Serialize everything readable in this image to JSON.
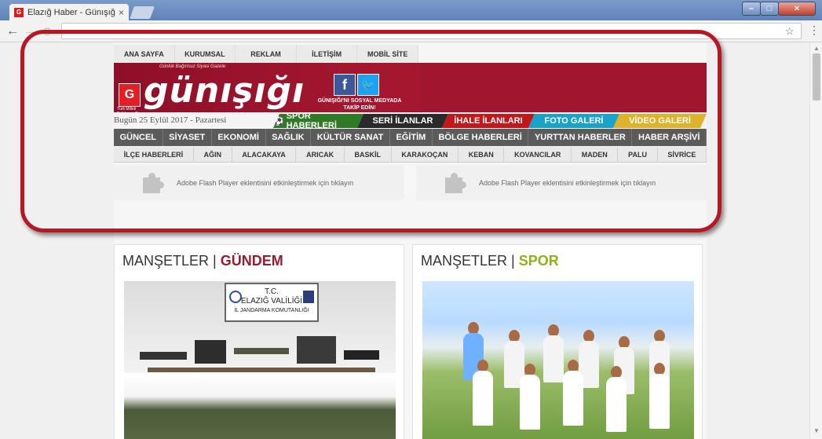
{
  "browser": {
    "tab_title": "Elazığ Haber - Günışığı G",
    "tab_close": "×",
    "tab_favicon": "G",
    "url": "",
    "icons": [
      "back-arrow-icon",
      "forward-arrow-icon",
      "reload-icon",
      "star-icon",
      "menu-dots-icon"
    ],
    "window_controls": {
      "minimize": "–",
      "maximize": "□",
      "close": "×"
    }
  },
  "site": {
    "top_menu": [
      "ANA SAYFA",
      "KURUMSAL",
      "REKLAM",
      "İLETİŞİM",
      "MOBİL SİTE"
    ],
    "logo_text": "günışığı",
    "logo_tagline": "Günlük Bağımsız Siyasi Gazete",
    "logo_flag": "G",
    "logo_sub": "Türk Milleti Belirleyen Bir Gazetedir",
    "social_text_line1": "GÜNIŞIĞI'NI SOSYAL MEDYADA",
    "social_text_line2": "TAKİP EDİN!",
    "date": "Bugün 25 Eylül 2017 - Pazartesi",
    "color_tabs": [
      {
        "label": "SPOR HABERLERİ",
        "color": "#2f7a26"
      },
      {
        "label": "SERİ İLANLAR",
        "color": "#2a2a2a"
      },
      {
        "label": "İHALE İLANLARI",
        "color": "#c4171c"
      },
      {
        "label": "FOTO GALERİ",
        "color": "#1aa3c9"
      },
      {
        "label": "VİDEO GALERİ",
        "color": "#e0b12a"
      }
    ],
    "main_nav": [
      "GÜNCEL",
      "SİYASET",
      "EKONOMİ",
      "SAĞLIK",
      "KÜLTÜR SANAT",
      "EĞİTİM",
      "BÖLGE HABERLERİ",
      "YURTTAN HABERLER",
      "HABER ARŞİVİ"
    ],
    "district_nav": [
      "İLÇE HABERLERİ",
      "AĞIN",
      "ALACAKAYA",
      "ARICAK",
      "BASKİL",
      "KARAKOÇAN",
      "KEBAN",
      "KOVANCILAR",
      "MADEN",
      "PALU",
      "SİVRİCE"
    ],
    "flash_text": "Adobe Flash Player eklentisini etkinleştirmek için tıklayın",
    "news": [
      {
        "prefix": "MANŞETLER | ",
        "accent": "GÜNDEM",
        "accent_color": "#9c1a2e"
      },
      {
        "prefix": "MANŞETLER | ",
        "accent": "SPOR",
        "accent_color": "#8db31a"
      }
    ],
    "sign_line1": "T.C.",
    "sign_line2": "ELAZIĞ VALİLİĞİ",
    "sign_line3": "İL JANDARMA KOMUTANLIĞI"
  },
  "colors": {
    "brand": "#a5172f",
    "highlight": "#b51823"
  }
}
